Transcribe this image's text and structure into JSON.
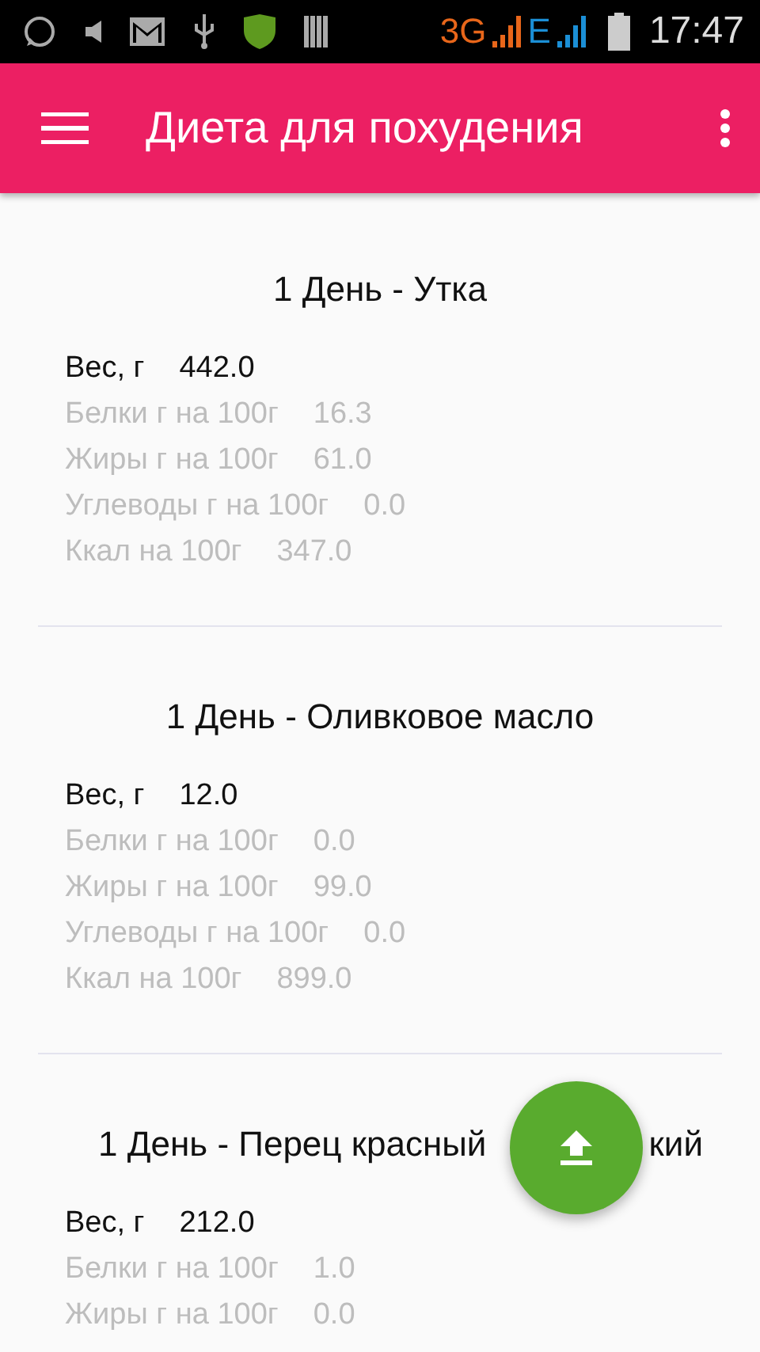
{
  "status_bar": {
    "network": "3G",
    "network_2": "E",
    "time": "17:47"
  },
  "app_bar": {
    "title": "Диета для похудения"
  },
  "sections": [
    {
      "title": "1 День - Утка",
      "rows": [
        {
          "kind": "primary",
          "label": "Вес, г",
          "value": "442.0"
        },
        {
          "kind": "secondary",
          "label": "Белки г на 100г",
          "value": "16.3"
        },
        {
          "kind": "secondary",
          "label": "Жиры г на 100г",
          "value": "61.0"
        },
        {
          "kind": "secondary",
          "label": "Углеводы г на 100г",
          "value": "0.0"
        },
        {
          "kind": "secondary",
          "label": "Ккал на 100г",
          "value": "347.0"
        }
      ]
    },
    {
      "title": "1 День - Оливковое масло",
      "rows": [
        {
          "kind": "primary",
          "label": "Вес, г",
          "value": "12.0"
        },
        {
          "kind": "secondary",
          "label": "Белки г на 100г",
          "value": "0.0"
        },
        {
          "kind": "secondary",
          "label": "Жиры г на 100г",
          "value": "99.0"
        },
        {
          "kind": "secondary",
          "label": "Углеводы г на 100г",
          "value": "0.0"
        },
        {
          "kind": "secondary",
          "label": "Ккал на 100г",
          "value": "899.0"
        }
      ]
    },
    {
      "title": "1 День - Перец красный",
      "title_end": "кий",
      "rows": [
        {
          "kind": "primary",
          "label": "Вес, г",
          "value": "212.0"
        },
        {
          "kind": "secondary",
          "label": "Белки г на 100г",
          "value": "1.0"
        },
        {
          "kind": "secondary",
          "label": "Жиры г на 100г",
          "value": "0.0"
        }
      ]
    }
  ]
}
